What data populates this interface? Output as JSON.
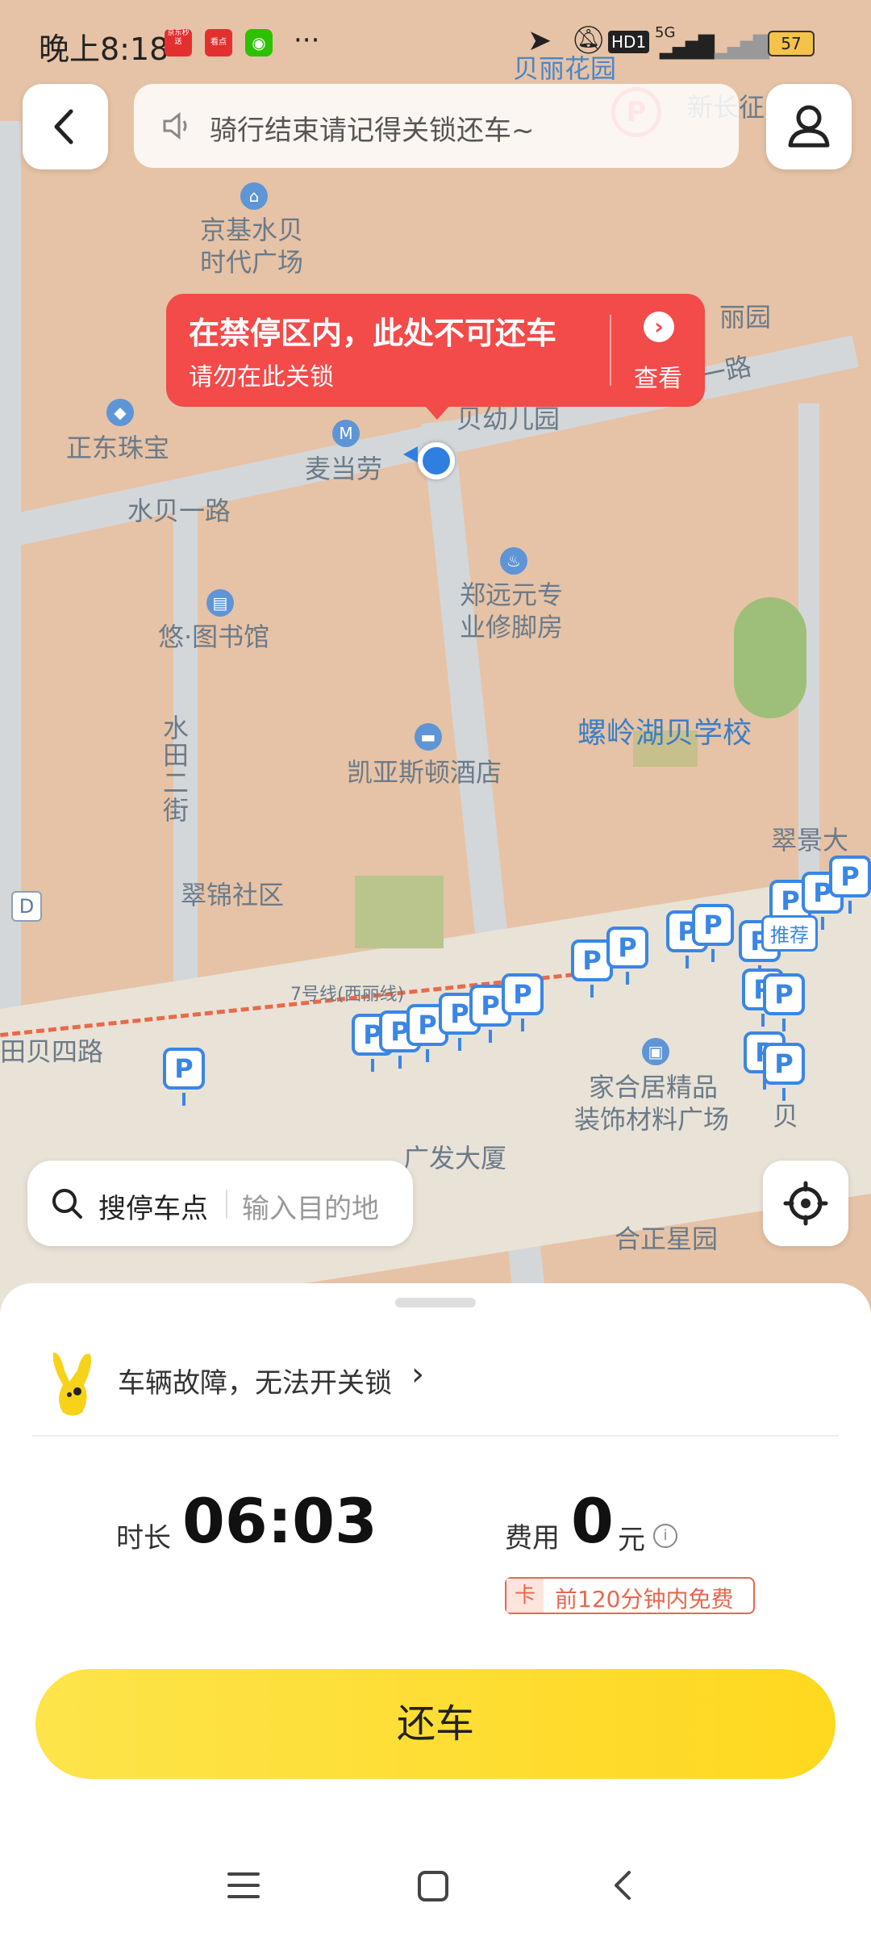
{
  "status_bar": {
    "time": "晚上8:18",
    "app_badges": [
      "京东秒送",
      "看点"
    ],
    "more": "···",
    "network": "5G",
    "hd": "HD1",
    "battery": "57"
  },
  "notice": {
    "text": "骑行结束请记得关锁还车~"
  },
  "callout": {
    "title": "在禁停区内，此处不可还车",
    "subtitle": "请勿在此关锁",
    "action": "查看"
  },
  "map": {
    "labels": [
      {
        "key": "beili_garden",
        "text": "贝丽花园"
      },
      {
        "key": "xinchang",
        "text": "新长征"
      },
      {
        "key": "jingji_1",
        "text": "京基水贝"
      },
      {
        "key": "jingji_2",
        "text": "时代广场"
      },
      {
        "key": "lili",
        "text": "丽园"
      },
      {
        "key": "beiyi",
        "text": "贝一路"
      },
      {
        "key": "kindergarten",
        "text": "贝幼儿园"
      },
      {
        "key": "zhengdong",
        "text": "正东珠宝"
      },
      {
        "key": "mcd",
        "text": "麦当劳"
      },
      {
        "key": "shuibei1",
        "text": "水贝一路"
      },
      {
        "key": "zheng_1",
        "text": "郑远元专"
      },
      {
        "key": "zheng_2",
        "text": "业修脚房"
      },
      {
        "key": "library",
        "text": "悠·图书馆"
      },
      {
        "key": "shuitian",
        "text": "水田二街"
      },
      {
        "key": "school",
        "text": "螺岭湖贝学校"
      },
      {
        "key": "hotel",
        "text": "凯亚斯顿酒店"
      },
      {
        "key": "cuijing",
        "text": "翠景大"
      },
      {
        "key": "cuijin",
        "text": "翠锦社区"
      },
      {
        "key": "line7",
        "text": "7号线(西丽线)"
      },
      {
        "key": "beisi",
        "text": "田贝四路"
      },
      {
        "key": "jiahe_1",
        "text": "家合居精品"
      },
      {
        "key": "jiahe_2",
        "text": "装饰材料广场"
      },
      {
        "key": "bei",
        "text": "贝"
      },
      {
        "key": "guangfa",
        "text": "广发大厦"
      },
      {
        "key": "hezheng",
        "text": "合正星园"
      },
      {
        "key": "recommend",
        "text": "推荐"
      },
      {
        "key": "d_marker",
        "text": "D"
      }
    ],
    "parking_marker": "P"
  },
  "search": {
    "label": "搜停车点",
    "placeholder": "输入目的地"
  },
  "sheet": {
    "fault_text": "车辆故障，无法开关锁",
    "duration_label": "时长",
    "duration_value": "06:03",
    "fee_label": "费用",
    "fee_value": "0",
    "fee_unit": "元",
    "card_tag": "卡",
    "card_text": "前120分钟内免费",
    "return_label": "还车"
  },
  "colors": {
    "accent_yellow": "#ffd81f",
    "alert_red": "#f34a4a",
    "parking_blue": "#3a86e5"
  }
}
